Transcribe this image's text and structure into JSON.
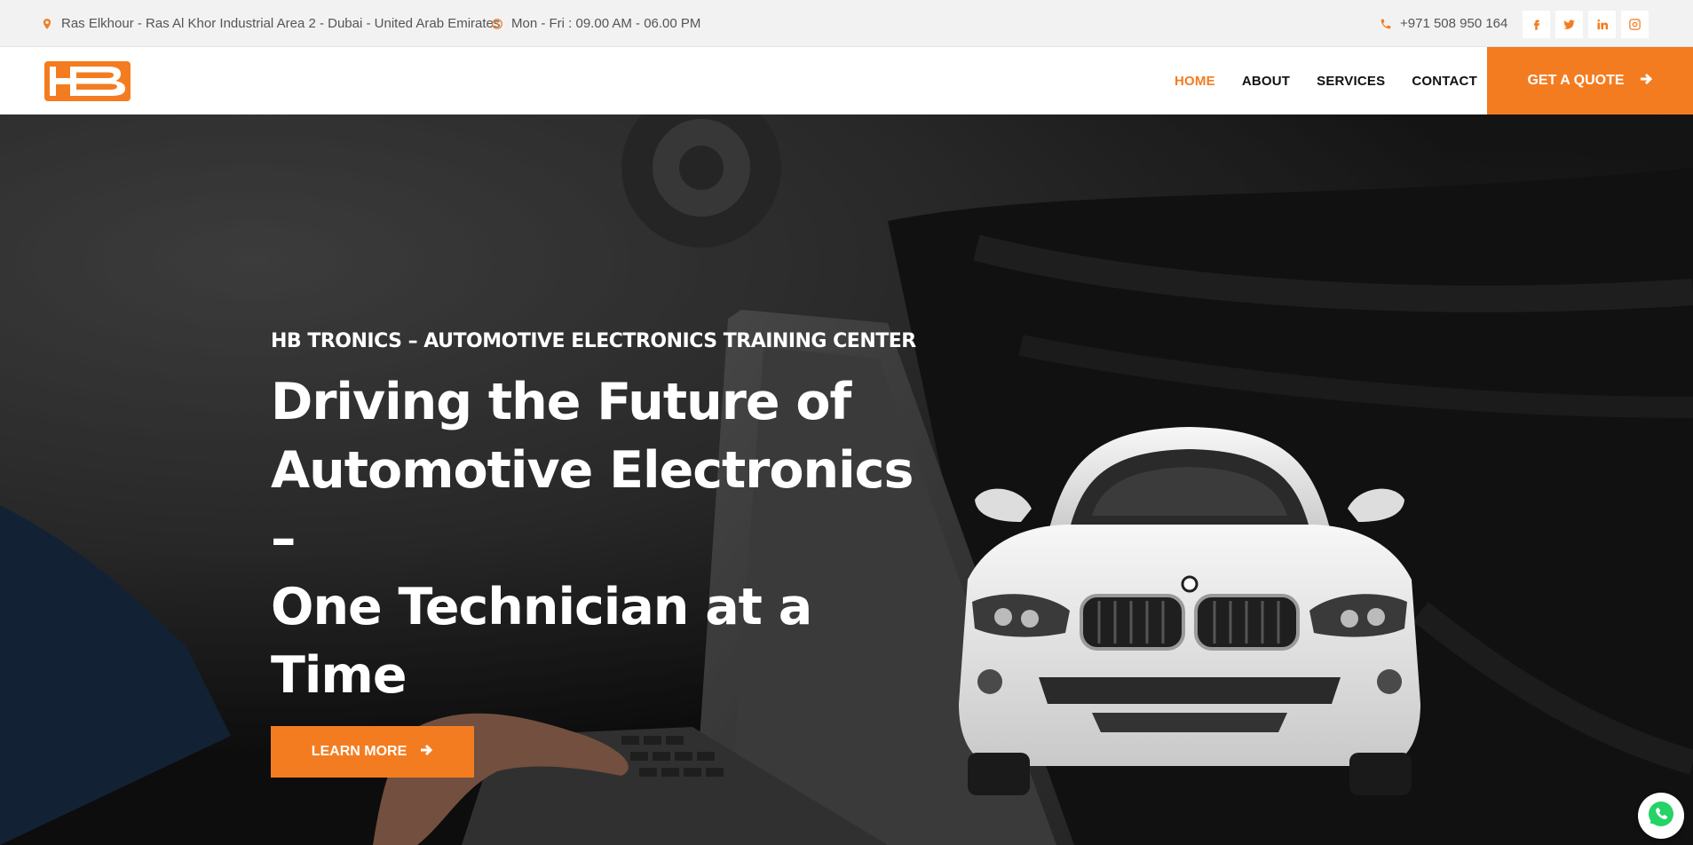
{
  "topbar": {
    "address": "Ras Elkhour - Ras Al Khor Industrial Area 2 - Dubai - United Arab Emirates",
    "hours": "Mon - Fri : 09.00 AM - 06.00 PM",
    "phone": "+971 508 950 164",
    "socials": [
      "facebook-icon",
      "twitter-icon",
      "linkedin-icon",
      "instagram-icon"
    ]
  },
  "nav": {
    "logo_text": "HB",
    "items": [
      "HOME",
      "ABOUT",
      "SERVICES",
      "CONTACT"
    ],
    "active": "HOME",
    "cta": "GET A QUOTE"
  },
  "hero": {
    "eyebrow": "HB TRONICS – AUTOMOTIVE ELECTRONICS TRAINING CENTER",
    "headline_line1": "Driving the Future of",
    "headline_line2": "Automotive Electronics –",
    "headline_line3": "One Technician at a Time",
    "button": "LEARN MORE"
  },
  "colors": {
    "accent": "#f47c20",
    "topbar_bg": "#f2f2f2",
    "text_dark": "#111111"
  }
}
